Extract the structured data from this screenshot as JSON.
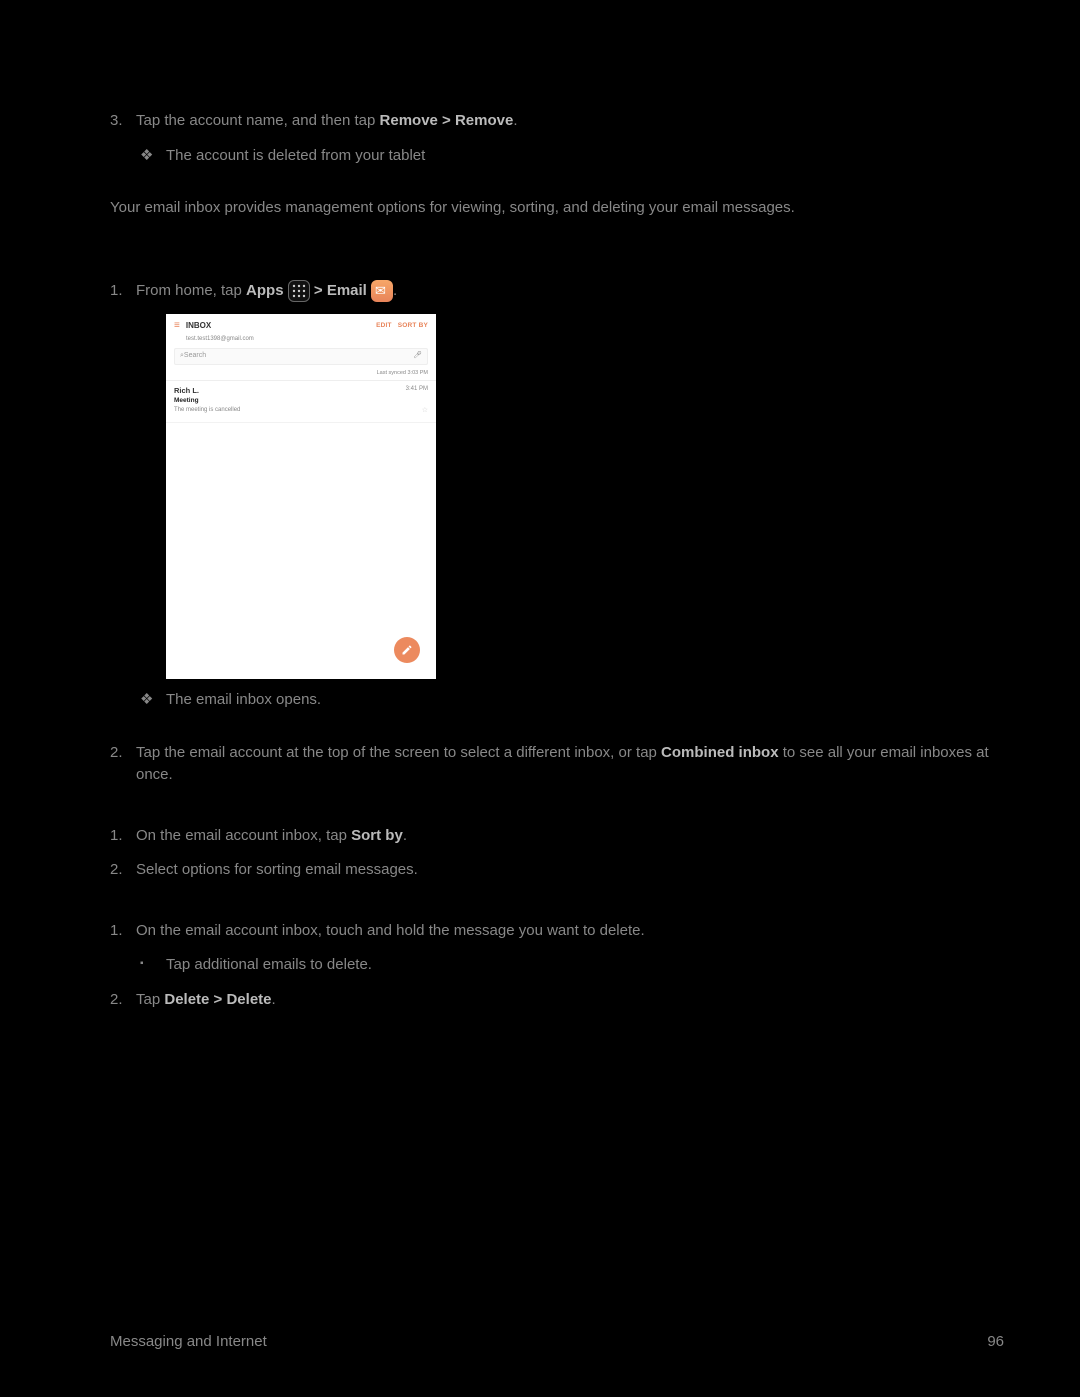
{
  "step3": {
    "num": "3.",
    "text_prefix": "Tap the account name, and then tap ",
    "bold": "Remove > Remove",
    "text_suffix": ".",
    "bullet_mark": "❖",
    "bullet_text": "The account is deleted from your tablet"
  },
  "intro": "Your email inbox provides management options for viewing, sorting, and deleting your email messages.",
  "view_inbox": {
    "step1_num": "1.",
    "step1_prefix": "From home, tap ",
    "step1_apps": "Apps",
    "step1_mid": " > ",
    "step1_email": "Email",
    "step1_suffix": ".",
    "bullet_mark": "❖",
    "bullet_text": "The email inbox opens.",
    "step2_num": "2.",
    "step2_prefix": "Tap the email account at the top of the screen to select a different inbox, or tap ",
    "step2_bold": "Combined inbox",
    "step2_suffix": " to see all your email inboxes at once."
  },
  "sort": {
    "step1_num": "1.",
    "step1_prefix": "On the email account inbox, tap ",
    "step1_bold": "Sort by",
    "step1_suffix": ".",
    "step2_num": "2.",
    "step2_text": "Select options for sorting email messages."
  },
  "delete": {
    "step1_num": "1.",
    "step1_text": "On the email account inbox, touch and hold the message you want to delete.",
    "sub_mark": "▪",
    "sub_text": "Tap additional emails to delete.",
    "step2_num": "2.",
    "step2_prefix": "Tap ",
    "step2_bold": "Delete > Delete",
    "step2_suffix": "."
  },
  "screenshot": {
    "inbox_label": "INBOX",
    "edit": "EDIT",
    "sort_by": "SORT BY",
    "account": "test.test1398@gmail.com",
    "search_placeholder": "Search",
    "sync": "Last synced 3:03 PM",
    "sender": "Rich L.",
    "time": "3:41 PM",
    "subject": "Meeting",
    "preview": "The meeting is cancelled",
    "star": "☆"
  },
  "footer": {
    "section": "Messaging and Internet",
    "page": "96"
  }
}
